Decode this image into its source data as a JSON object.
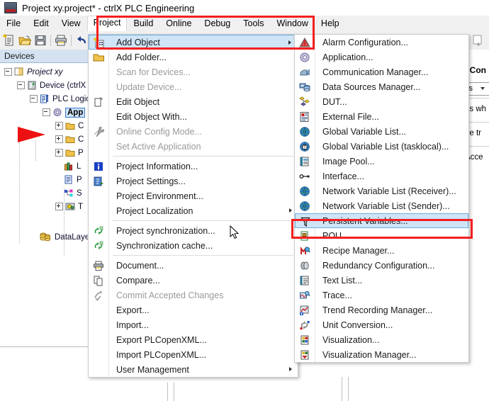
{
  "window": {
    "title": "Project xy.project* - ctrlX PLC Engineering",
    "app_icon": "plc-app-icon"
  },
  "menubar": {
    "items": [
      {
        "label": "File",
        "active": false
      },
      {
        "label": "Edit",
        "active": false
      },
      {
        "label": "View",
        "active": false
      },
      {
        "label": "Project",
        "active": true
      },
      {
        "label": "Build",
        "active": false
      },
      {
        "label": "Online",
        "active": false
      },
      {
        "label": "Debug",
        "active": false
      },
      {
        "label": "Tools",
        "active": false
      },
      {
        "label": "Window",
        "active": false
      },
      {
        "label": "Help",
        "active": false
      }
    ]
  },
  "toolbar": {
    "buttons": [
      {
        "name": "new-project-icon"
      },
      {
        "name": "open-project-icon"
      },
      {
        "name": "save-project-icon"
      },
      {
        "name": "print-icon"
      },
      {
        "name": "undo-icon"
      }
    ]
  },
  "devices": {
    "header": "Devices",
    "tree": [
      {
        "label": "Project xy",
        "indent": 0,
        "expander": "minus",
        "icon": "project-icon",
        "italic": true,
        "selected": false
      },
      {
        "label": "Device (ctrlX",
        "indent": 1,
        "expander": "minus",
        "icon": "device-icon",
        "italic": false,
        "selected": false
      },
      {
        "label": "PLC Logic",
        "indent": 2,
        "expander": "minus",
        "icon": "plc-logic-icon",
        "italic": false,
        "selected": false
      },
      {
        "label": "App",
        "indent": 3,
        "expander": "minus",
        "icon": "application-icon",
        "italic": false,
        "selected": true
      },
      {
        "label": "C",
        "indent": 4,
        "expander": "plus",
        "icon": "folder-icon",
        "italic": false,
        "selected": false
      },
      {
        "label": "C",
        "indent": 4,
        "expander": "plus",
        "icon": "folder-icon",
        "italic": false,
        "selected": false
      },
      {
        "label": "P",
        "indent": 4,
        "expander": "plus",
        "icon": "folder-icon",
        "italic": false,
        "selected": false
      },
      {
        "label": "L",
        "indent": 4,
        "expander": "none",
        "icon": "library-manager-icon",
        "italic": false,
        "selected": false
      },
      {
        "label": "P",
        "indent": 4,
        "expander": "none",
        "icon": "pou-icon",
        "italic": false,
        "selected": false
      },
      {
        "label": "S",
        "indent": 4,
        "expander": "none",
        "icon": "symbol-config-icon",
        "italic": false,
        "selected": false
      },
      {
        "label": "T",
        "indent": 4,
        "expander": "plus",
        "icon": "task-config-icon",
        "italic": false,
        "selected": false
      },
      {
        "label": "DataLayer",
        "indent": 2,
        "expander": "none",
        "icon": "datalayer-icon",
        "italic": false,
        "selected": false
      }
    ],
    "pointer_annotation": "red-arrow-pointing-to-application"
  },
  "right_panel": {
    "title": "l Con",
    "combo_value": "is",
    "lines": [
      "es wh",
      "be tr",
      "Acce"
    ]
  },
  "project_menu": {
    "items": [
      {
        "label": "Add Object",
        "icon": "add-object-icon",
        "disabled": false,
        "submenu": true,
        "highlighted": true
      },
      {
        "label": "Add Folder...",
        "icon": "add-folder-icon",
        "disabled": false,
        "submenu": false,
        "highlighted": false
      },
      {
        "label": "Scan for Devices...",
        "icon": "none",
        "disabled": true,
        "submenu": false,
        "highlighted": false
      },
      {
        "label": "Update Device...",
        "icon": "none",
        "disabled": true,
        "submenu": false,
        "highlighted": false
      },
      {
        "label": "Edit Object",
        "icon": "edit-object-icon",
        "disabled": false,
        "submenu": false,
        "highlighted": false
      },
      {
        "label": "Edit Object With...",
        "icon": "none",
        "disabled": false,
        "submenu": false,
        "highlighted": false
      },
      {
        "label": "Online Config Mode...",
        "icon": "wrench-icon",
        "disabled": true,
        "submenu": false,
        "highlighted": false
      },
      {
        "label": "Set Active Application",
        "icon": "none",
        "disabled": true,
        "submenu": false,
        "highlighted": false
      },
      {
        "separator": true
      },
      {
        "label": "Project Information...",
        "icon": "info-icon",
        "disabled": false,
        "submenu": false,
        "highlighted": false
      },
      {
        "label": "Project Settings...",
        "icon": "settings-icon",
        "disabled": false,
        "submenu": false,
        "highlighted": false
      },
      {
        "label": "Project Environment...",
        "icon": "none",
        "disabled": false,
        "submenu": false,
        "highlighted": false
      },
      {
        "label": "Project Localization",
        "icon": "none",
        "disabled": false,
        "submenu": true,
        "highlighted": false
      },
      {
        "separator": true
      },
      {
        "label": "Project synchronization...",
        "icon": "sync-icon",
        "disabled": false,
        "submenu": false,
        "highlighted": false
      },
      {
        "label": "Synchronization cache...",
        "icon": "sync-icon",
        "disabled": false,
        "submenu": false,
        "highlighted": false
      },
      {
        "separator": true
      },
      {
        "label": "Document...",
        "icon": "printer-icon",
        "disabled": false,
        "submenu": false,
        "highlighted": false
      },
      {
        "label": "Compare...",
        "icon": "compare-icon",
        "disabled": false,
        "submenu": false,
        "highlighted": false
      },
      {
        "label": "Commit Accepted Changes",
        "icon": "commit-icon",
        "disabled": true,
        "submenu": false,
        "highlighted": false
      },
      {
        "label": "Export...",
        "icon": "none",
        "disabled": false,
        "submenu": false,
        "highlighted": false
      },
      {
        "label": "Import...",
        "icon": "none",
        "disabled": false,
        "submenu": false,
        "highlighted": false
      },
      {
        "label": "Export PLCopenXML...",
        "icon": "none",
        "disabled": false,
        "submenu": false,
        "highlighted": false
      },
      {
        "label": "Import PLCopenXML...",
        "icon": "none",
        "disabled": false,
        "submenu": false,
        "highlighted": false
      },
      {
        "label": "User Management",
        "icon": "none",
        "disabled": false,
        "submenu": true,
        "highlighted": false
      }
    ]
  },
  "add_object_menu": {
    "items": [
      {
        "label": "Alarm Configuration...",
        "icon": "alarm-configuration-icon",
        "highlighted": false
      },
      {
        "label": "Application...",
        "icon": "application-icon",
        "highlighted": false
      },
      {
        "label": "Communication Manager...",
        "icon": "communication-manager-icon",
        "highlighted": false
      },
      {
        "label": "Data Sources Manager...",
        "icon": "data-sources-manager-icon",
        "highlighted": false
      },
      {
        "label": "DUT...",
        "icon": "dut-icon",
        "highlighted": false
      },
      {
        "label": "External File...",
        "icon": "external-file-icon",
        "highlighted": false
      },
      {
        "label": "Global Variable List...",
        "icon": "global-variable-list-icon",
        "highlighted": false
      },
      {
        "label": "Global Variable List (tasklocal)...",
        "icon": "global-variable-list-tasklocal-icon",
        "highlighted": false
      },
      {
        "label": "Image Pool...",
        "icon": "image-pool-icon",
        "highlighted": false
      },
      {
        "label": "Interface...",
        "icon": "interface-icon",
        "highlighted": false
      },
      {
        "label": "Network Variable List (Receiver)...",
        "icon": "network-variable-list-receiver-icon",
        "highlighted": false
      },
      {
        "label": "Network Variable List (Sender)...",
        "icon": "network-variable-list-sender-icon",
        "highlighted": false
      },
      {
        "label": "Persistent Variables...",
        "icon": "persistent-variables-icon",
        "highlighted": true
      },
      {
        "label": "POU...",
        "icon": "pou-icon",
        "highlighted": false
      },
      {
        "label": "Recipe Manager...",
        "icon": "recipe-manager-icon",
        "highlighted": false
      },
      {
        "label": "Redundancy Configuration...",
        "icon": "redundancy-configuration-icon",
        "highlighted": false
      },
      {
        "label": "Text List...",
        "icon": "text-list-icon",
        "highlighted": false
      },
      {
        "label": "Trace...",
        "icon": "trace-icon",
        "highlighted": false
      },
      {
        "label": "Trend Recording Manager...",
        "icon": "trend-recording-manager-icon",
        "highlighted": false
      },
      {
        "label": "Unit Conversion...",
        "icon": "unit-conversion-icon",
        "highlighted": false
      },
      {
        "label": "Visualization...",
        "icon": "visualization-icon",
        "highlighted": false
      },
      {
        "label": "Visualization Manager...",
        "icon": "visualization-manager-icon",
        "highlighted": false
      }
    ]
  },
  "annotations": {
    "highlight_color": "#f41f1f",
    "boxes": [
      "project-menu-tab",
      "add-object-item",
      "persistent-variables-item"
    ],
    "arrow": "red-arrow"
  }
}
